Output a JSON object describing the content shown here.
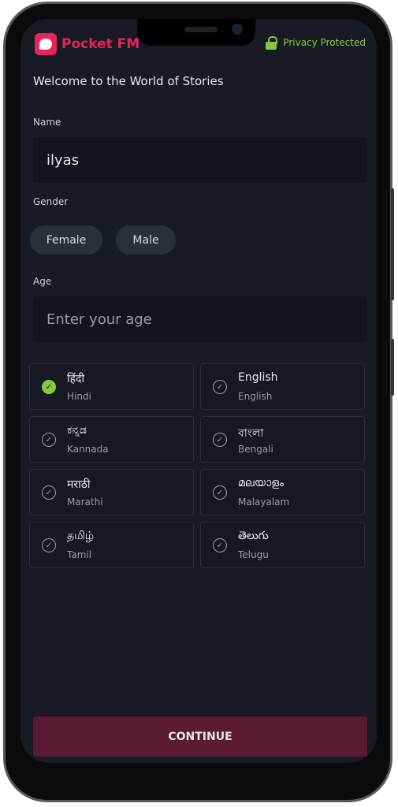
{
  "header": {
    "app_name": "Pocket FM",
    "privacy": "Privacy Protected"
  },
  "welcome": "Welcome to the World of Stories",
  "name": {
    "label": "Name",
    "value": "ilyas"
  },
  "gender": {
    "label": "Gender",
    "options": [
      "Female",
      "Male"
    ]
  },
  "age": {
    "label": "Age",
    "placeholder": "Enter your age"
  },
  "languages": [
    {
      "native": "हिंदी",
      "english": "Hindi",
      "selected": true
    },
    {
      "native": "English",
      "english": "English",
      "selected": false
    },
    {
      "native": "ಕನ್ನಡ",
      "english": "Kannada",
      "selected": false
    },
    {
      "native": "বাংলা",
      "english": "Bengali",
      "selected": false
    },
    {
      "native": "मराठी",
      "english": "Marathi",
      "selected": false
    },
    {
      "native": "മലയാളം",
      "english": "Malayalam",
      "selected": false
    },
    {
      "native": "தமிழ்",
      "english": "Tamil",
      "selected": false
    },
    {
      "native": "తెలుగు",
      "english": "Telugu",
      "selected": false
    }
  ],
  "continue_label": "CONTINUE",
  "colors": {
    "brand": "#e8245a",
    "accent_green": "#8cc63f",
    "continue_bg": "#5a1a33",
    "background": "#181b24"
  }
}
